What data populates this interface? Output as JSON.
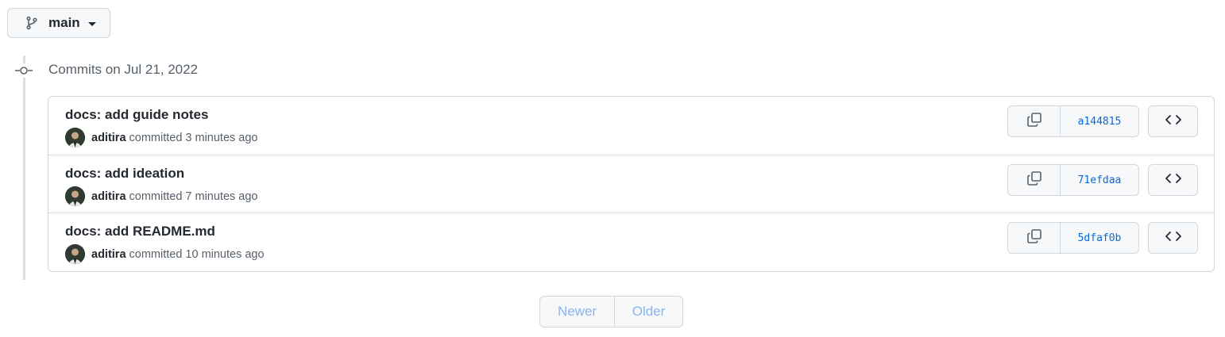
{
  "branch": {
    "name": "main",
    "icon": "git-branch-icon"
  },
  "timeline": {
    "heading": "Commits on Jul 21, 2022",
    "icon": "git-commit-icon"
  },
  "commits": [
    {
      "title": "docs: add guide notes",
      "author": "aditira",
      "action": "committed",
      "time": "3 minutes ago",
      "sha": "a144815"
    },
    {
      "title": "docs: add ideation",
      "author": "aditira",
      "action": "committed",
      "time": "7 minutes ago",
      "sha": "71efdaa"
    },
    {
      "title": "docs: add README.md",
      "author": "aditira",
      "action": "committed",
      "time": "10 minutes ago",
      "sha": "5dfaf0b"
    }
  ],
  "commit_buttons": {
    "copy_icon": "copy-icon",
    "browse_icon": "code-icon"
  },
  "pagination": {
    "newer": "Newer",
    "older": "Older",
    "disabled_color": "#8cb4ea"
  },
  "colors": {
    "link": "#0969da",
    "border": "#d0d7de",
    "button_bg": "#f6f8fa"
  }
}
